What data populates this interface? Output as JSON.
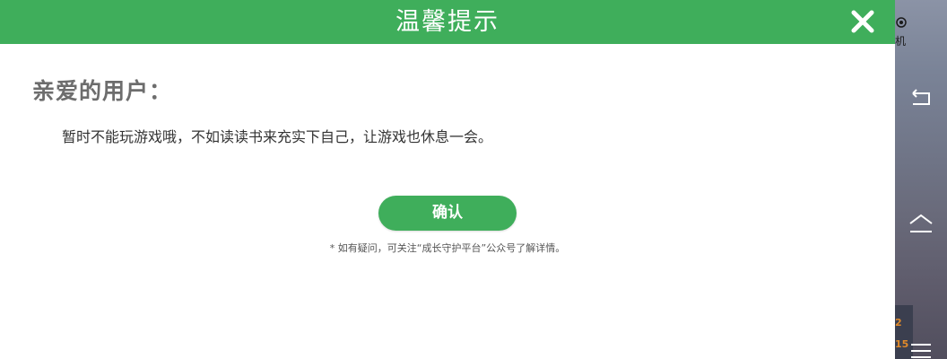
{
  "dialog": {
    "title": "温馨提示",
    "greeting": "亲爱的用户：",
    "message": "暂时不能玩游戏哦，不如读读书来充实下自己，让游戏也休息一会。",
    "confirm_label": "确认",
    "hint": "* 如有疑问，可关注“成长守护平台”公众号了解详情。",
    "close_icon": "close-icon"
  },
  "side": {
    "top_label": "机",
    "numbers": [
      "2",
      "15"
    ],
    "icons": [
      "back-icon",
      "home-icon",
      "menu-icon"
    ]
  },
  "colors": {
    "accent": "#3fae5b",
    "greeting_text": "#6d6d6d"
  }
}
